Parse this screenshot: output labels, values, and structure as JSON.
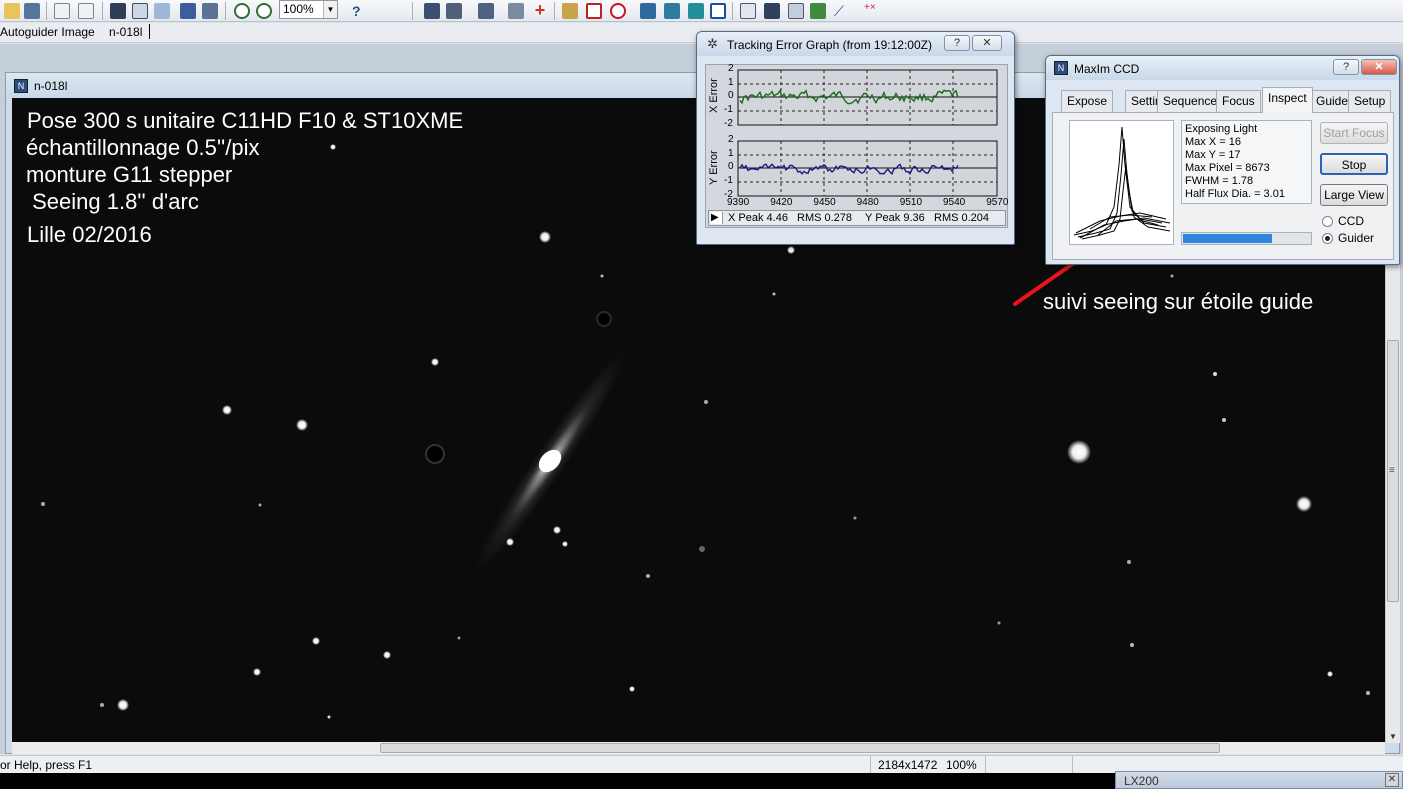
{
  "toolbar": {
    "zoom_value": "100%",
    "icons": [
      "open-icon",
      "save-icon",
      "undo-icon",
      "redo-icon",
      "image-icon",
      "fit-icon",
      "pin-icon",
      "star-icon",
      "settings-icon",
      "zoom-in-icon",
      "zoom-out-icon",
      "help-icon"
    ]
  },
  "second_bar": {
    "label": "Autoguider Image",
    "tab": "n-018l"
  },
  "image_window": {
    "title": "n-018l"
  },
  "annotations": {
    "line1": "Pose 300 s  unitaire   C11HD F10  & ST10XME",
    "line2": "échantillonnage 0.5''/pix",
    "line3": "monture G11 stepper",
    "line4": " Seeing 1.8'' d'arc",
    "line5": "Lille 02/2016",
    "arrow_note": "suivi seeing sur étoile guide",
    "arrow_color": "#e8141c"
  },
  "tracking_graph": {
    "title": "Tracking Error Graph (from 19:12:00Z)",
    "x_axis_label": "X Error",
    "y_axis_label": "Y Error",
    "y_ticks": [
      "2",
      "1",
      "0",
      "-1",
      "-2"
    ],
    "x_ticks": [
      "9390",
      "9420",
      "9450",
      "9480",
      "9510",
      "9540",
      "9570"
    ],
    "stats": {
      "x_peak": "X Peak 4.46",
      "x_rms": "RMS 0.278",
      "y_peak": "Y Peak 9.36",
      "y_rms": "RMS 0.204"
    },
    "x_series_color": "#1b6b1b",
    "y_series_color": "#1c1c80"
  },
  "maxim": {
    "title": "MaxIm CCD",
    "tabs": [
      "Expose",
      "Settings",
      "Sequence",
      "Focus",
      "Inspect",
      "Guide",
      "Setup"
    ],
    "active_tab": "Inspect",
    "info_lines": [
      "Exposing Light",
      "Max X = 16",
      "Max Y = 17",
      "Max Pixel = 8673",
      "FWHM = 1.78",
      "Half Flux Dia. = 3.01"
    ],
    "buttons": {
      "start_focus": "Start Focus",
      "stop": "Stop",
      "large_view": "Large View"
    },
    "radio_ccd": "CCD",
    "radio_guider": "Guider",
    "selected_radio": "Guider",
    "progress": 0.7
  },
  "status_bar": {
    "help": "or Help, press F1",
    "dims": "2184x1472",
    "zoom": "100%"
  },
  "lx200": {
    "title": "LX200"
  }
}
